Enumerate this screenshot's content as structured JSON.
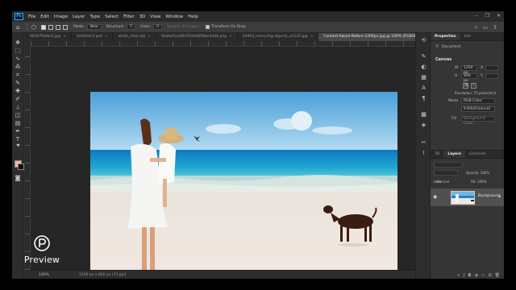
{
  "app": {
    "logo": "Ps"
  },
  "menu": [
    "File",
    "Edit",
    "Image",
    "Layer",
    "Type",
    "Select",
    "Filter",
    "3D",
    "View",
    "Window",
    "Help"
  ],
  "window_controls": [
    "–",
    "❐",
    "✕"
  ],
  "options_bar": {
    "mode_label": "Mode:",
    "mode_value": "New",
    "structure_label": "Structure:",
    "structure_value": "5",
    "color_label": "Color:",
    "color_value": "0",
    "sample_all_layers": "Sample All Layers",
    "transform_on_drop": "Transform On Drop"
  },
  "tabs": [
    {
      "label": "66197fe0bc2.jpg",
      "active": false
    },
    {
      "label": "Untitled-2.psd",
      "active": false
    },
    {
      "label": "white_chair.obj",
      "active": false
    },
    {
      "label": "ShakeFive46d7b5d4406be344b.png",
      "active": false
    },
    {
      "label": "24454_removing-objects_o1120.jpg",
      "active": false
    },
    {
      "label": "Content-Aware-Before-1200px.jpg @ 100% (RGB/8#)",
      "active": true
    }
  ],
  "status": {
    "zoom": "100%",
    "doc_size": "1200 px x 800 px (72 ppi)"
  },
  "properties": {
    "tabs": [
      "Properties",
      "Info"
    ],
    "doc_label": "Document",
    "canvas_section": "Canvas",
    "w_label": "W",
    "w_value": "1200 px",
    "h_label": "H",
    "h_value": "800 px",
    "x_label": "X",
    "y_label": "Y",
    "resolution": "Resolution: 72 pixels/inch",
    "mode_label": "Mode",
    "mode_value": "RGB Color",
    "bits_value": "8 Bits/Channel",
    "fill_label": "Fill",
    "fill_value": "Background Color"
  },
  "layers": {
    "tabs": [
      "3D",
      "Layers",
      "Channels"
    ],
    "kind_label": "Kind",
    "blend": "Normal",
    "opacity": "Opacity: 100%",
    "lock_label": "Lock:",
    "fill": "Fill: 100%",
    "layer_name": "Background"
  },
  "watermark": {
    "text": "Preview"
  },
  "colors": {
    "foreground": "#f4b8a4",
    "background": "#1a0d0a",
    "accent": "#31a8ff"
  }
}
